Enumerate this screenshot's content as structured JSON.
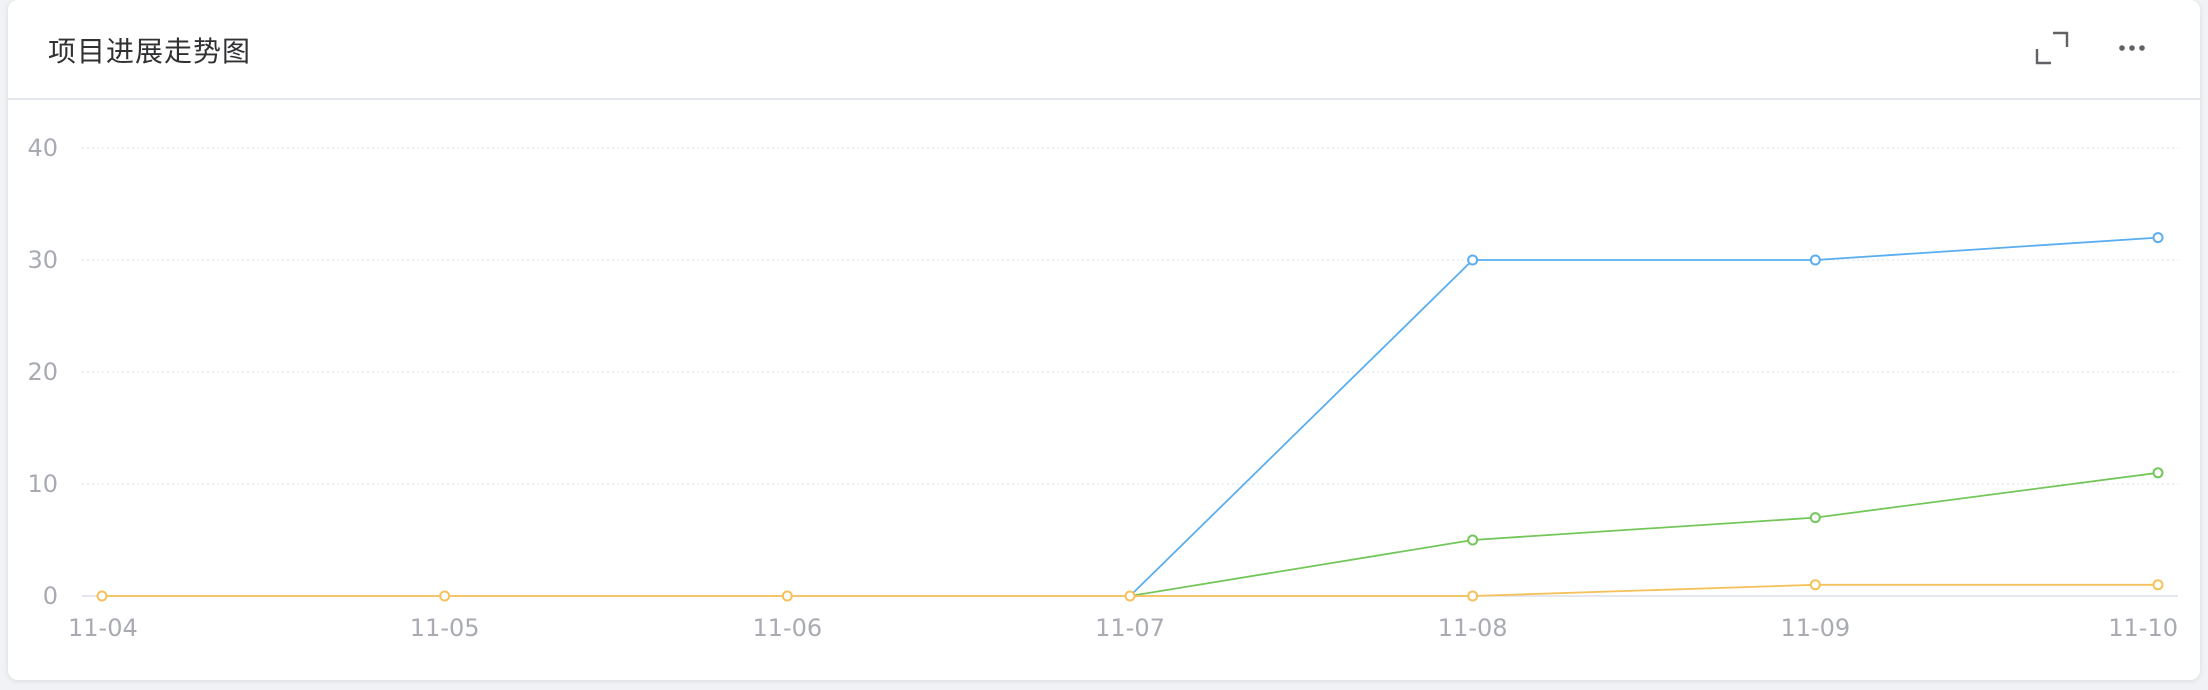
{
  "card": {
    "title": "项目进展走势图",
    "expand_icon": "expand-icon",
    "more_icon": "more-horizontal-icon"
  },
  "colors": {
    "grid": "#dcdfe6",
    "axis_text": "#a8abb2",
    "series": [
      "#5aaef0",
      "#73c75a",
      "#f5c15a"
    ]
  },
  "chart_data": {
    "type": "line",
    "title": "项目进展走势图",
    "xlabel": "",
    "ylabel": "",
    "categories": [
      "11-04",
      "11-05",
      "11-06",
      "11-07",
      "11-08",
      "11-09",
      "11-10"
    ],
    "y_ticks": [
      0,
      10,
      20,
      30,
      40
    ],
    "ylim": [
      0,
      40
    ],
    "grid": true,
    "legend": "none",
    "series": [
      {
        "values": [
          0,
          0,
          0,
          0,
          30,
          30,
          32
        ]
      },
      {
        "values": [
          0,
          0,
          0,
          0,
          5,
          7,
          11
        ]
      },
      {
        "values": [
          0,
          0,
          0,
          0,
          0,
          1,
          1
        ]
      }
    ]
  }
}
